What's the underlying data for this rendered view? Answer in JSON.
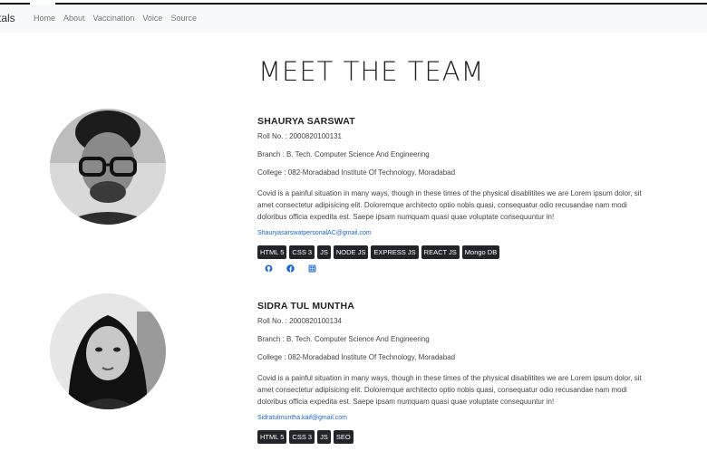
{
  "nav": {
    "brand": "tals",
    "links": [
      "Home",
      "About",
      "Vaccination",
      "Voice",
      "Source"
    ]
  },
  "page": {
    "title": "MEET THE TEAM"
  },
  "members": [
    {
      "name": "SHAURYA SARSWAT",
      "roll": "Roll No. : 2000820100131",
      "branch": "Branch : B. Tech. Computer Science And Engineering",
      "college": "College : 082-Moradabad Institute Of Technology, Moradabad",
      "bio": "Covid is a painful situation in many ways, though in these times of the physical disablitites we are Lorem ipsum dolor, sit amet consectetur adipisicing elit. Doloremque architecto optio nobis quasi, consequatur odio recusandae nam modi doloribus officia expedita est. Saepe ipsam numquam quasi quae voluptate consequuntur in!",
      "email": "ShauryasarswatpersonalAC@gmail.com",
      "tags": [
        "HTML 5",
        "CSS 3",
        "JS",
        "NODE JS",
        "EXPRESS JS",
        "REACT JS",
        "Mongo DB"
      ],
      "socials": [
        "github-icon",
        "facebook-icon",
        "linkedin-icon"
      ]
    },
    {
      "name": "SIDRA TUL MUNTHA",
      "roll": "Roll No. : 2000820100134",
      "branch": "Branch : B. Tech. Computer Science And Engineering",
      "college": "College : 082-Moradabad Institute Of Technology, Moradabad",
      "bio": "Covid is a painful situation in many ways, though in these times of the physical disablitites we are Lorem ipsum dolor, sit amet consectetur adipisicing elit. Doloremque architecto optio nobis quasi, consequatur odio recusandae nam modi doloribus officia expedita est. Saepe ipsam numquam quasi quae voluptate consequuntur in!",
      "email": "Sidratulmuntha.kaif@gmail.com",
      "tags": [
        "HTML 5",
        "CSS 3",
        "JS",
        "SEO"
      ]
    }
  ],
  "colors": {
    "link": "#1a66d6",
    "tag_bg": "#212529",
    "navbar_bg": "#f8f9fa"
  }
}
